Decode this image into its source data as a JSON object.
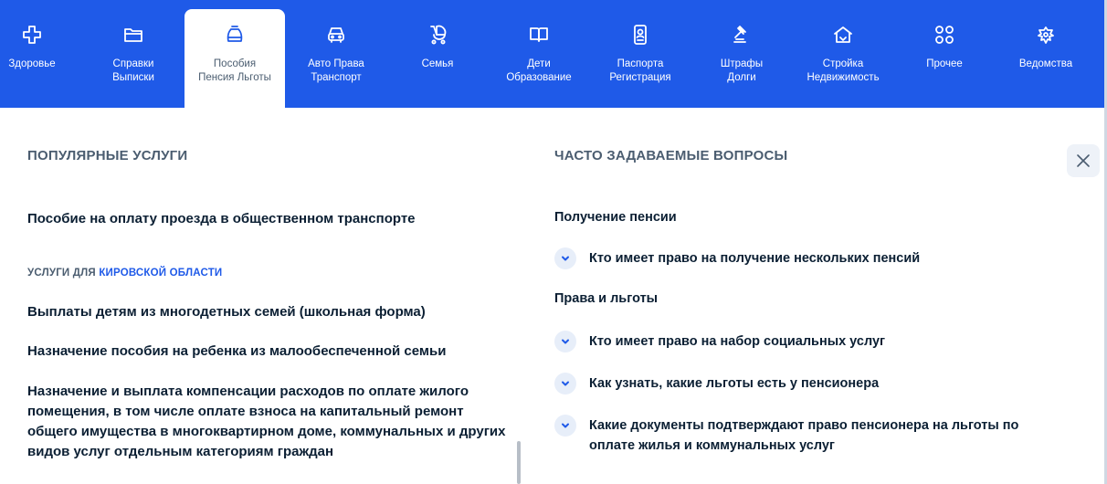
{
  "nav": {
    "items": [
      {
        "label": "Здоровье",
        "icon": "health-cross-icon"
      },
      {
        "label": "Справки\nВыписки",
        "icon": "folder-icon"
      },
      {
        "label": "Пособия\nПенсия Льготы",
        "icon": "wallet-bag-icon",
        "active": true
      },
      {
        "label": "Авто Права\nТранспорт",
        "icon": "car-icon"
      },
      {
        "label": "Семья",
        "icon": "stroller-icon"
      },
      {
        "label": "Дети\nОбразование",
        "icon": "book-icon"
      },
      {
        "label": "Паспорта\nРегистрация",
        "icon": "passport-icon"
      },
      {
        "label": "Штрафы\nДолги",
        "icon": "gavel-icon"
      },
      {
        "label": "Стройка\nНедвижимость",
        "icon": "house-icon"
      },
      {
        "label": "Прочее",
        "icon": "grid-icon"
      },
      {
        "label": "Ведомства",
        "icon": "coat-of-arms-icon"
      }
    ],
    "colors": {
      "bar": "#1f5ae8",
      "active_bg": "#ffffff"
    }
  },
  "popular": {
    "title": "ПОПУЛЯРНЫЕ УСЛУГИ",
    "top_service": "Пособие на оплату проезда в общественном транспорте",
    "region_prefix": "УСЛУГИ ДЛЯ",
    "region_name": "КИРОВСКОЙ ОБЛАСТИ",
    "services": [
      "Выплаты детям из многодетных семей (школьная форма)",
      "Назначение пособия на ребенка из малообеспеченной семьи",
      "Назначение и выплата компенсации расходов по оплате жилого помещения, в том числе оплате взноса на капитальный ремонт общего имущества в многоквартирном доме, коммунальных и других видов услуг отдельным категориям граждан"
    ]
  },
  "faq": {
    "title": "ЧАСТО ЗАДАВАЕМЫЕ ВОПРОСЫ",
    "groups": [
      {
        "title": "Получение пенсии",
        "questions": [
          "Кто имеет право на получение нескольких пенсий"
        ]
      },
      {
        "title": "Права и льготы",
        "questions": [
          "Кто имеет право на набор социальных услуг",
          "Как узнать, какие льготы есть у пенсионера",
          "Какие документы подтверждают право пенсионера на льготы по оплате жилья и коммунальных услуг"
        ]
      }
    ]
  },
  "close_icon": "close-icon"
}
